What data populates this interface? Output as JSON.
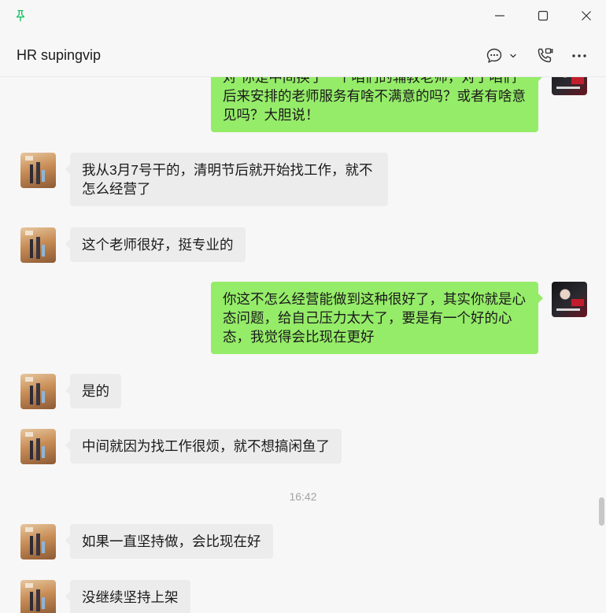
{
  "window": {
    "title": "HR supingvip"
  },
  "title_bar": {
    "pin_icon": "pin-icon",
    "minimize_icon": "minimize-icon",
    "maximize_icon": "maximize-icon",
    "close_icon": "close-icon"
  },
  "header_actions": {
    "chat_icon": "chat-bubble-icon",
    "dropdown_icon": "chevron-down-icon",
    "call_icon": "phone-video-icon",
    "more_icon": "more-icon"
  },
  "colors": {
    "pin": "#07c160",
    "outgoing_bubble": "#95ec69",
    "incoming_bubble": "#ececec",
    "background": "#f7f7f7",
    "timestamp": "#a3a3a3"
  },
  "messages": [
    {
      "from_me": true,
      "text": "对“你是中间换了一个咱们的辅教老师，对于咱们后来安排的老师服务有啥不满意的吗？或者有啥意见吗？大胆说！"
    },
    {
      "from_me": false,
      "text": "我从3月7号干的，清明节后就开始找工作，就不怎么经营了"
    },
    {
      "from_me": false,
      "text": "这个老师很好，挺专业的"
    },
    {
      "from_me": true,
      "text": "你这不怎么经营能做到这种很好了，其实你就是心态问题，给自己压力太大了，要是有一个好的心态，我觉得会比现在更好"
    },
    {
      "from_me": false,
      "text": "是的"
    },
    {
      "from_me": false,
      "text": "中间就因为找工作很烦，就不想搞闲鱼了"
    },
    {
      "from_me": false,
      "text": "如果一直坚持做，会比现在好"
    },
    {
      "from_me": false,
      "text": "没继续坚持上架"
    }
  ],
  "timestamp": "16:42"
}
